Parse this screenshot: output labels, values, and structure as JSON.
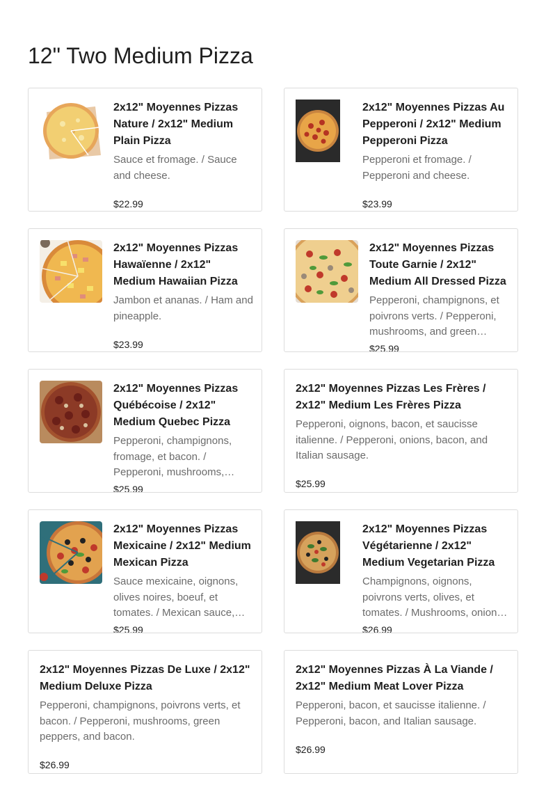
{
  "page": {
    "title": "12\" Two Medium Pizza"
  },
  "items": [
    {
      "name": "2x12\" Moyennes Pizzas Nature / 2x12\" Medium Plain Pizza",
      "description": "Sauce et fromage. / Sauce and cheese.",
      "price": "$22.99",
      "image": "plain-pizza-image"
    },
    {
      "name": "2x12\" Moyennes Pizzas Au Pepperoni / 2x12\" Medium Pepperoni Pizza",
      "description": "Pepperoni et fromage. / Pepperoni and cheese.",
      "price": "$23.99",
      "image": "pepperoni-pizza-image"
    },
    {
      "name": "2x12\" Moyennes Pizzas Hawaïenne / 2x12\" Medium Hawaiian Pizza",
      "description": "Jambon et ananas. / Ham and pineapple.",
      "price": "$23.99",
      "image": "hawaiian-pizza-image"
    },
    {
      "name": "2x12\" Moyennes Pizzas Toute Garnie / 2x12\" Medium All Dressed Pizza",
      "description": "Pepperoni, champignons, et poivrons verts. / Pepperoni, mushrooms, and green peppers.",
      "price": "$25.99",
      "image": "all-dressed-pizza-image"
    },
    {
      "name": "2x12\" Moyennes Pizzas Québécoise / 2x12\" Medium Quebec Pizza",
      "description": "Pepperoni, champignons, fromage, et bacon. / Pepperoni, mushrooms, cheese, and bacon.",
      "price": "$25.99",
      "image": "quebec-pizza-image"
    },
    {
      "name": "2x12\" Moyennes Pizzas Les Frères / 2x12\" Medium Les Frères Pizza",
      "description": "Pepperoni, oignons, bacon, et saucisse italienne. / Pepperoni, onions, bacon, and Italian sausage.",
      "price": "$25.99",
      "image": ""
    },
    {
      "name": "2x12\" Moyennes Pizzas Mexicaine / 2x12\" Medium Mexican Pizza",
      "description": "Sauce mexicaine, oignons, olives noires, boeuf, et tomates. / Mexican sauce, onions, black olives, beef, and tomatoes.",
      "price": "$25.99",
      "image": "mexican-pizza-image"
    },
    {
      "name": "2x12\" Moyennes Pizzas Végétarienne / 2x12\" Medium Vegetarian Pizza",
      "description": "Champignons, oignons, poivrons verts, olives, et tomates. / Mushrooms, onions, green peppers, olives, and tomatoes.",
      "price": "$26.99",
      "image": "vegetarian-pizza-image"
    },
    {
      "name": "2x12\" Moyennes Pizzas De Luxe / 2x12\" Medium Deluxe Pizza",
      "description": "Pepperoni, champignons, poivrons verts, et bacon. / Pepperoni, mushrooms, green peppers, and bacon.",
      "price": "$26.99",
      "image": ""
    },
    {
      "name": "2x12\" Moyennes Pizzas À La Viande / 2x12\" Medium Meat Lover Pizza",
      "description": "Pepperoni, bacon, et saucisse italienne. / Pepperoni, bacon, and Italian sausage.",
      "price": "$26.99",
      "image": ""
    }
  ]
}
